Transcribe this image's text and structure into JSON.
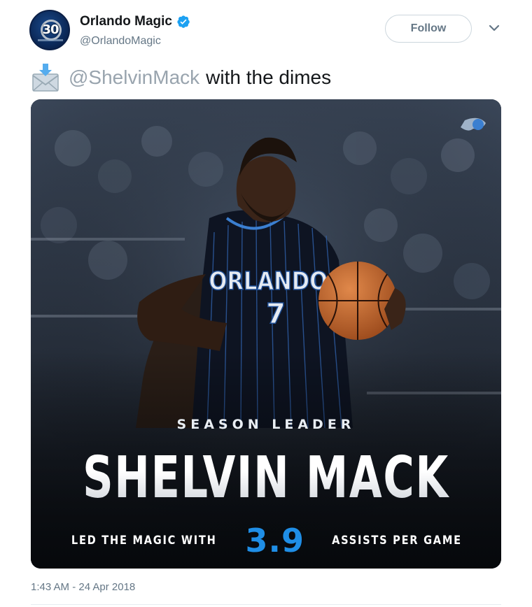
{
  "account": {
    "display_name": "Orlando Magic",
    "handle": "@OrlandoMagic",
    "avatar_badge": "30",
    "verified": true
  },
  "actions": {
    "follow_label": "Follow"
  },
  "tweet": {
    "mention": "@ShelvinMack",
    "text": "with the dimes",
    "emoji": "incoming-envelope-icon"
  },
  "graphic": {
    "jersey_text": "ORLANDO",
    "jersey_number": "7",
    "kicker": "SEASON LEADER",
    "player_name": "SHELVIN MACK",
    "stat_prefix": "LED THE MAGIC WITH",
    "stat_value": "3.9",
    "stat_suffix": "ASSISTS PER GAME",
    "accent_color": "#1f8ee6"
  },
  "meta": {
    "timestamp": "1:43 AM - 24 Apr 2018"
  },
  "colors": {
    "handle_gray": "#657786",
    "verified_blue": "#1da1f2",
    "text": "#14171a"
  }
}
